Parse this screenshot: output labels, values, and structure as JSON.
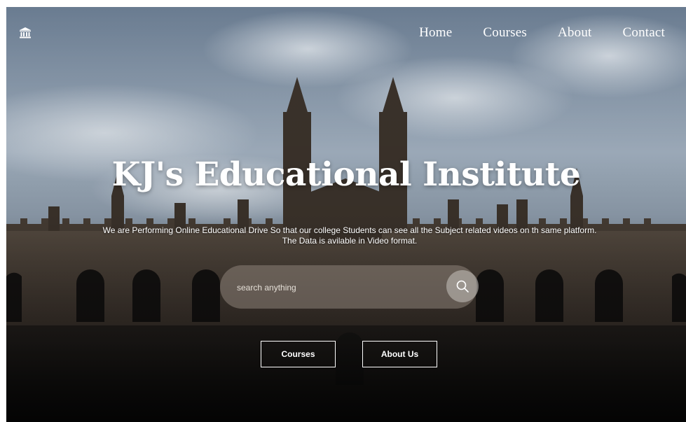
{
  "header": {
    "logo_icon": "university-icon",
    "nav": [
      {
        "label": "Home"
      },
      {
        "label": "Courses"
      },
      {
        "label": "About"
      },
      {
        "label": "Contact"
      }
    ]
  },
  "hero": {
    "title": "KJ's Educational Institute",
    "subtitle": "We are Performing Online Educational Drive So that our college Students can see all the Subject related videos on th same platform. The Data is avilable in Video format.",
    "search": {
      "placeholder": "search anything",
      "value": "",
      "icon": "search-icon"
    },
    "buttons": {
      "courses": "Courses",
      "about": "About Us"
    }
  },
  "colors": {
    "text": "#ffffff",
    "search_pill": "#8c8278",
    "sky": "#9fb2c6",
    "stone": "#4a4037"
  }
}
